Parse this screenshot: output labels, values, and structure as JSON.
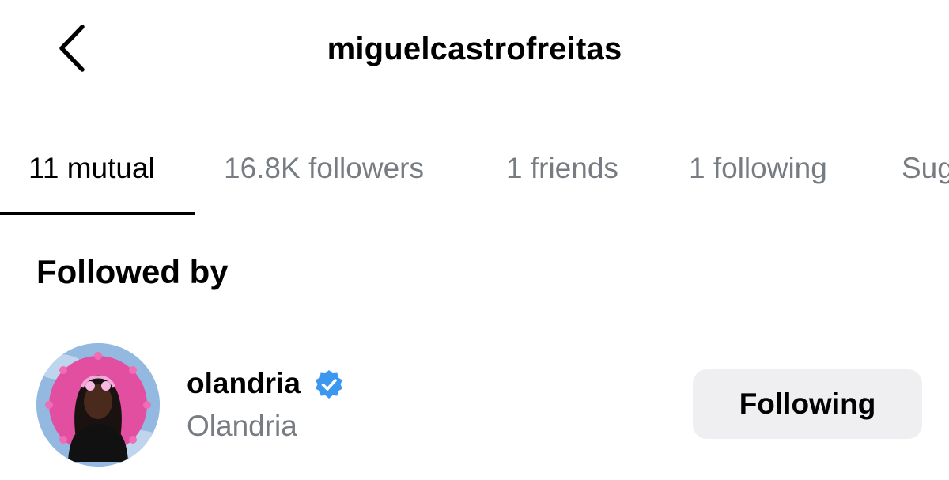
{
  "header": {
    "title": "miguelcastrofreitas",
    "back_icon": "chevron-left-icon"
  },
  "tabs": [
    {
      "label": "11 mutual",
      "active": true
    },
    {
      "label": "16.8K followers",
      "active": false
    },
    {
      "label": "1 friends",
      "active": false
    },
    {
      "label": "1 following",
      "active": false
    },
    {
      "label": "Sug",
      "active": false
    }
  ],
  "section": {
    "heading": "Followed by"
  },
  "users": [
    {
      "username": "olandria",
      "full_name": "Olandria",
      "verified": true,
      "verified_icon": "verified-badge-icon",
      "button_label": "Following"
    }
  ],
  "colors": {
    "primary_text": "#000000",
    "secondary_text": "#777c82",
    "verified_blue": "#3b97f0",
    "button_bg": "#efeff2",
    "divider": "#e6e6e6"
  }
}
